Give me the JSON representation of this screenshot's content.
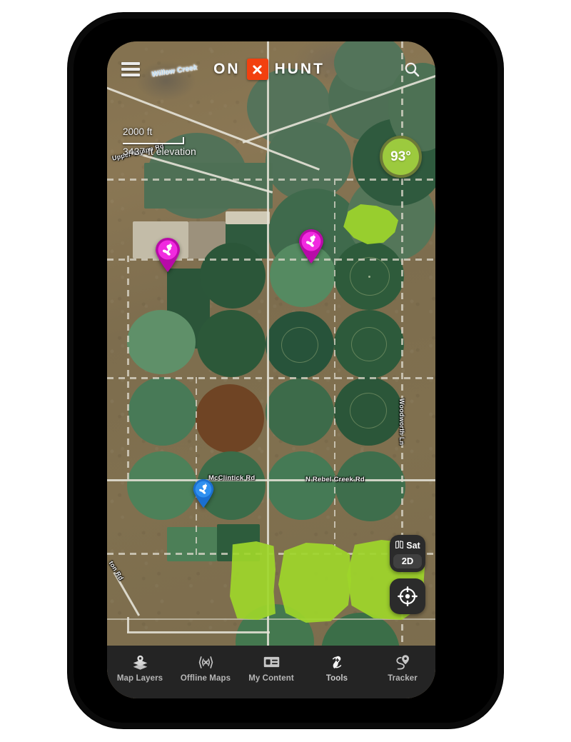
{
  "app": {
    "brand_left": "ON",
    "brand_right": "HUNT",
    "logo_icon": "x-mark-icon",
    "menu_icon": "hamburger-menu-icon",
    "search_icon": "search-icon"
  },
  "map_overlay": {
    "scale_label": "2000 ft",
    "elevation_label": "3437 ft elevation",
    "temperature": "93°"
  },
  "map_controls": {
    "basemap_label": "Sat",
    "basemap_icon": "map-book-icon",
    "dimension_label": "2D",
    "compass_icon": "compass-crosshair-icon"
  },
  "map_labels": [
    {
      "text": "Willow Creek",
      "type": "water"
    },
    {
      "text": "Upper Strapp Rd",
      "type": "road"
    },
    {
      "text": "McClintick Rd",
      "type": "road"
    },
    {
      "text": "N Rebel Creek Rd",
      "type": "road"
    },
    {
      "text": "Woodworth Ln",
      "type": "road"
    },
    {
      "text": "ton Rd",
      "type": "road"
    }
  ],
  "map_pins": [
    {
      "label": "waypoint-pheasant-1",
      "color": "#d60fc9",
      "icon": "bird-icon"
    },
    {
      "label": "waypoint-pheasant-2",
      "color": "#d60fc9",
      "icon": "bird-icon"
    },
    {
      "label": "waypoint-pheasant-3",
      "color": "#2080e8",
      "icon": "bird-icon"
    }
  ],
  "colors": {
    "brand_accent": "#f2400f",
    "public_land": "#9ed62a",
    "temp_fill": "#9cca3e",
    "temp_ring": "#6d7a37",
    "pin_magenta": "#d60fc9",
    "pin_blue": "#2080e8",
    "nav_background": "#242424"
  },
  "bottom_nav": [
    {
      "label": "Map Layers",
      "icon": "layers-icon",
      "active": false
    },
    {
      "label": "Offline Maps",
      "icon": "offline-wifi-icon",
      "active": false
    },
    {
      "label": "My Content",
      "icon": "content-card-icon",
      "active": false
    },
    {
      "label": "Tools",
      "icon": "tools-icon",
      "active": true
    },
    {
      "label": "Tracker",
      "icon": "tracker-pin-icon",
      "active": false
    }
  ]
}
